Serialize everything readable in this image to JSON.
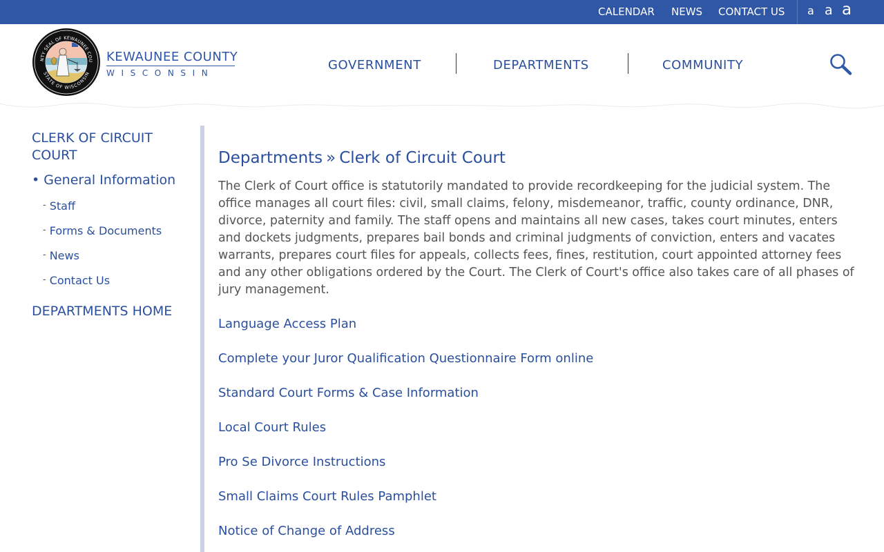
{
  "utility_nav": {
    "calendar": "CALENDAR",
    "news": "NEWS",
    "contact_us": "CONTACT US",
    "font_sizes": [
      "a",
      "a",
      "a"
    ]
  },
  "brand": {
    "name": "KEWAUNEE COUNTY",
    "subtitle": "WISCONSIN",
    "seal_text_top": "COUNTY SEAL OF KEWAUNEE COUNTY",
    "seal_text_bottom": "STATE OF WISCONSIN"
  },
  "main_nav": {
    "items": [
      "GOVERNMENT",
      "DEPARTMENTS",
      "COMMUNITY"
    ],
    "search_icon": "magnifier-icon"
  },
  "sidebar": {
    "section_title": "CLERK OF CIRCUIT COURT",
    "current_item": "General Information",
    "current_bullet": "•",
    "sub_dash": "-",
    "sub_items": [
      "Staff",
      "Forms & Documents",
      "News",
      "Contact Us"
    ],
    "home_link": "DEPARTMENTS HOME"
  },
  "main": {
    "breadcrumb": {
      "parent": "Departments",
      "separator": "»",
      "current": "Clerk of Circuit Court"
    },
    "intro": "The Clerk of Court office is statutorily mandated to provide recordkeeping for the judicial system. The office manages all court files: civil, small claims, felony, misdemeanor, traffic, county ordinance, DNR, divorce, paternity and family. The staff opens and maintains all new cases, takes court minutes, enters and dockets judgments, prepares bail bonds and criminal judgments of conviction, enters and vacates warrants, prepares court files for appeals, collects fees, fines, restitution, court appointed attorney fees and any other obligations ordered by the Court. The Clerk of Court's office also takes care of all phases of jury management.",
    "links": [
      "Language Access Plan",
      "Complete your Juror Qualification Questionnaire Form online",
      "Standard Court Forms & Case Information",
      "Local Court Rules",
      "Pro Se Divorce Instructions",
      "Small Claims Court Rules Pamphlet",
      "Notice of Change of Address"
    ]
  },
  "colors": {
    "top_bar": "#3056a6",
    "link_blue": "#2a4f9e",
    "body_text": "#555555",
    "sidebar_rule": "#c9d3e4"
  }
}
